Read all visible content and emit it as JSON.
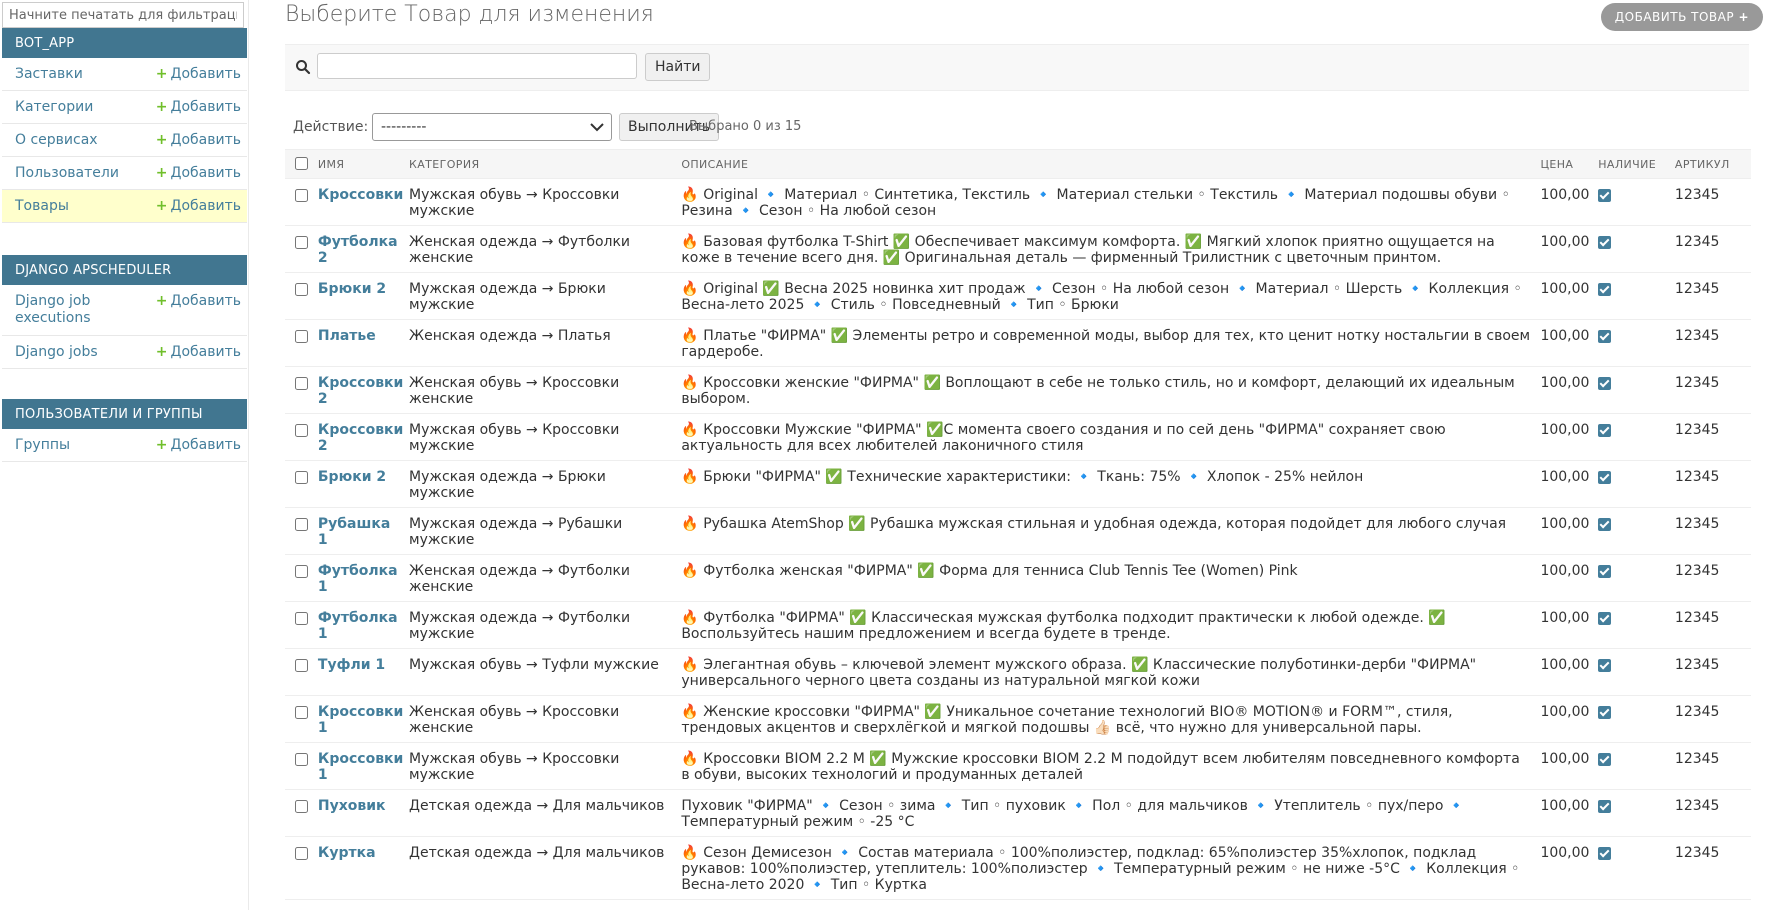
{
  "sidebar": {
    "filter_placeholder": "Начните печатать для фильтрации",
    "modules": [
      {
        "caption": "BOT_APP",
        "rows": [
          {
            "label": "Заставки",
            "add": "Добавить"
          },
          {
            "label": "Категории",
            "add": "Добавить"
          },
          {
            "label": "О сервисах",
            "add": "Добавить"
          },
          {
            "label": "Пользователи",
            "add": "Добавить"
          },
          {
            "label": "Товары",
            "add": "Добавить",
            "current": true
          }
        ]
      },
      {
        "caption": "DJANGO APSCHEDULER",
        "rows": [
          {
            "label": "Django job executions",
            "add": "Добавить"
          },
          {
            "label": "Django jobs",
            "add": "Добавить"
          }
        ]
      },
      {
        "caption": "ПОЛЬЗОВАТЕЛИ И ГРУППЫ",
        "rows": [
          {
            "label": "Группы",
            "add": "Добавить"
          }
        ]
      }
    ]
  },
  "main": {
    "title": "Выберите Товар для изменения",
    "add_button": "ДОБАВИТЬ ТОВАР",
    "search_button": "Найти",
    "search_value": "",
    "action_label": "Действие:",
    "action_selected": "---------",
    "action_go": "Выполнить",
    "action_counter": "Выбрано 0 из 15"
  },
  "table": {
    "headers": [
      "Имя",
      "Категория",
      "Описание",
      "Цена",
      "Наличие",
      "Артикул"
    ],
    "rows": [
      {
        "name": "Кроссовки",
        "category": "Мужская обувь → Кроссовки мужские",
        "description": "🔥 Original 🔹 Материал ◦ Синтетика, Текстиль 🔹 Материал стельки ◦ Текстиль 🔹 Материал подошвы обуви ◦ Резина 🔹 Сезон ◦ На любой сезон",
        "price": "100,00",
        "available": true,
        "sku": "12345"
      },
      {
        "name": "Футболка 2",
        "category": "Женская одежда → Футболки женские",
        "description": "🔥 Базовая футболка T-Shirt ✅ Обеспечивает максимум комфорта. ✅ Мягкий хлопок приятно ощущается на коже в течение всего дня. ✅ Оригинальная деталь — фирменный Трилистник с цветочным принтом.",
        "price": "100,00",
        "available": true,
        "sku": "12345"
      },
      {
        "name": "Брюки 2",
        "category": "Мужская одежда → Брюки мужские",
        "description": "🔥 Original ✅ Весна 2025 новинка хит продаж 🔹 Сезон ◦ На любой сезон 🔹 Материал ◦ Шерсть 🔹 Коллекция ◦ Весна-лето 2025 🔹 Стиль ◦ Повседневный 🔹 Тип ◦ Брюки",
        "price": "100,00",
        "available": true,
        "sku": "12345"
      },
      {
        "name": "Платье",
        "category": "Женская одежда → Платья",
        "description": "🔥 Платье \"ФИРМА\" ✅ Элементы ретро и современной моды, выбор для тех, кто ценит нотку ностальгии в своем гардеробе.",
        "price": "100,00",
        "available": true,
        "sku": "12345"
      },
      {
        "name": "Кроссовки 2",
        "category": "Женская обувь → Кроссовки женские",
        "description": "🔥 Кроссовки женские \"ФИРМА\" ✅ Воплощают в себе не только стиль, но и комфорт, делающий их идеальным выбором.",
        "price": "100,00",
        "available": true,
        "sku": "12345"
      },
      {
        "name": "Кроссовки 2",
        "category": "Мужская обувь → Кроссовки мужские",
        "description": "🔥 Кроссовки Мужские \"ФИРМА\" ✅С момента своего создания и по сей день \"ФИРМА\" сохраняет свою актуальность для всех любителей лаконичного стиля",
        "price": "100,00",
        "available": true,
        "sku": "12345"
      },
      {
        "name": "Брюки 2",
        "category": "Мужская одежда → Брюки мужские",
        "description": "🔥 Брюки \"ФИРМА\" ✅ Технические характеристики: 🔹 Ткань: 75% 🔹 Хлопок - 25% нейлон",
        "price": "100,00",
        "available": true,
        "sku": "12345"
      },
      {
        "name": "Рубашка 1",
        "category": "Мужская одежда → Рубашки мужские",
        "description": "🔥 Рубашка AtemShop ✅ Рубашка мужская стильная и удобная одежда, которая подойдет для любого случая",
        "price": "100,00",
        "available": true,
        "sku": "12345"
      },
      {
        "name": "Футболка 1",
        "category": "Женская одежда → Футболки женские",
        "description": "🔥 Футболка женская \"ФИРМА\" ✅ Форма для тенниса Club Tennis Tee (Women) Pink",
        "price": "100,00",
        "available": true,
        "sku": "12345"
      },
      {
        "name": "Футболка 1",
        "category": "Мужская одежда → Футболки мужские",
        "description": "🔥 Футболка \"ФИРМА\" ✅ Классическая мужская футболка подходит практически к любой одежде. ✅ Воспользуйтесь нашим предложением и всегда будете в тренде.",
        "price": "100,00",
        "available": true,
        "sku": "12345"
      },
      {
        "name": "Туфли 1",
        "category": "Мужская обувь → Туфли мужские",
        "description": "🔥 Элегантная обувь – ключевой элемент мужского образа. ✅ Классические полуботинки-дерби \"ФИРМА\" универсального черного цвета созданы из натуральной мягкой кожи",
        "price": "100,00",
        "available": true,
        "sku": "12345"
      },
      {
        "name": "Кроссовки 1",
        "category": "Женская обувь → Кроссовки женские",
        "description": "🔥 Женские кроссовки \"ФИРМА\" ✅ Уникальное сочетание технологий BIO® MOTION® и FORM™, стиля, трендовых акцентов и сверхлёгкой и мягкой подошвы 👍🏻 всё, что нужно для универсальной пары.",
        "price": "100,00",
        "available": true,
        "sku": "12345"
      },
      {
        "name": "Кроссовки 1",
        "category": "Мужская обувь → Кроссовки мужские",
        "description": "🔥 Кроссовки BIOM 2.2 M ✅ Мужские кроссовки BIOM 2.2 M подойдут всем любителям повседневного комфорта в обуви, высоких технологий и продуманных деталей",
        "price": "100,00",
        "available": true,
        "sku": "12345"
      },
      {
        "name": "Пуховик",
        "category": "Детская одежда → Для мальчиков",
        "description": "Пуховик \"ФИРМА\" 🔹 Сезон ◦ зима 🔹 Тип ◦ пуховик 🔹 Пол ◦ для мальчиков 🔹 Утеплитель ◦ пух/перо 🔹 Температурный режим ◦ -25 °C",
        "price": "100,00",
        "available": true,
        "sku": "12345"
      },
      {
        "name": "Куртка",
        "category": "Детская одежда → Для мальчиков",
        "description": "🔥 Сезон Демисезон 🔹 Состав материала ◦ 100%полиэстер, подклад: 65%полиэстер 35%хлопок, подклад рукавов: 100%полиэстер, утеплитель: 100%полиэстер 🔹 Температурный режим ◦ не ниже -5°C 🔹 Коллекция ◦ Весна-лето 2020 🔹 Тип ◦ Куртка",
        "price": "100,00",
        "available": true,
        "sku": "12345"
      }
    ]
  }
}
